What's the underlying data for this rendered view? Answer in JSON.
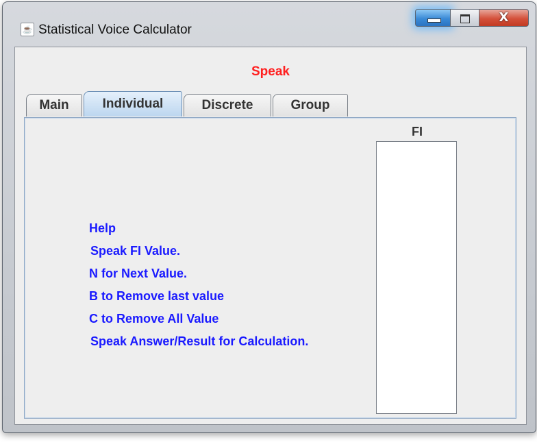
{
  "window": {
    "title": "Statistical Voice Calculator",
    "app_icon": "java-icon",
    "close_glyph": "X"
  },
  "header": {
    "speak_label": "Speak",
    "speak_color": "#ff2020"
  },
  "tabs": [
    {
      "label": "Main",
      "selected": false
    },
    {
      "label": "Individual",
      "selected": true
    },
    {
      "label": "Discrete",
      "selected": false
    },
    {
      "label": "Group",
      "selected": false
    }
  ],
  "help": {
    "lines": [
      "Help",
      "Speak FI Value.",
      "N for Next Value.",
      "B to Remove last value",
      "C to Remove All Value",
      "Speak Answer/Result for Calculation."
    ],
    "color": "#1a1aff"
  },
  "fi_column": {
    "header": "FI",
    "values": []
  }
}
